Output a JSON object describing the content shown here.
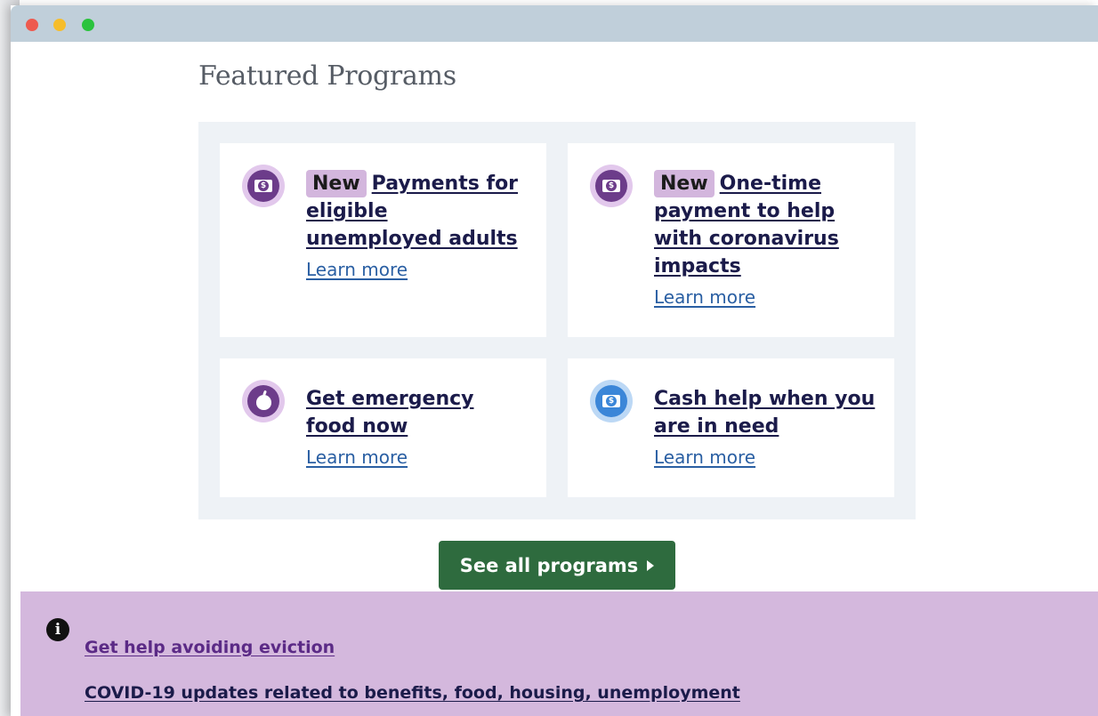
{
  "section": {
    "title": "Featured Programs"
  },
  "cards": [
    {
      "badge": "New",
      "title": "Payments for eligible unemployed adults",
      "learn_more": "Learn more",
      "icon": "money-icon"
    },
    {
      "badge": "New",
      "title": "One-time payment to help with coronavirus impacts",
      "learn_more": "Learn more",
      "icon": "money-icon"
    },
    {
      "title": "Get emergency food now",
      "learn_more": "Learn more",
      "icon": "apple-icon"
    },
    {
      "title": "Cash help when you are in need",
      "learn_more": "Learn more",
      "icon": "money-icon"
    }
  ],
  "cta": {
    "label": "See all programs"
  },
  "alert": {
    "icon": "info-icon",
    "links": [
      "Get help avoiding eviction",
      "COVID-19 updates related to benefits, food, housing, unemployment"
    ]
  },
  "colors": {
    "titlebar": "#c0cfda",
    "card_bg": "#eef2f6",
    "badge": "#d3b6dd",
    "cta": "#2e6b3e",
    "alert_bg": "#d4b8dd",
    "link": "#2a5fa3",
    "icon_purple": "#6c3c8a",
    "icon_blue": "#3b86d8"
  }
}
